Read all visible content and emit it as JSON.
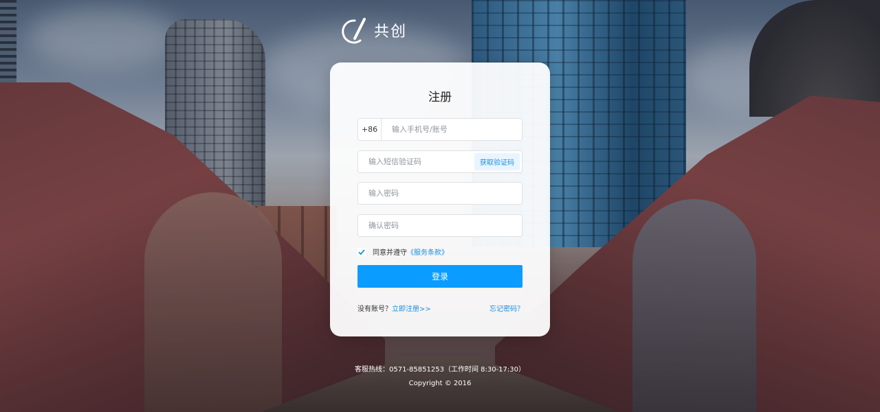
{
  "brand": {
    "name": "共创"
  },
  "form": {
    "title": "注册",
    "phone_prefix": "+86",
    "phone_placeholder": "输入手机号/账号",
    "code_placeholder": "输入短信验证码",
    "get_code_label": "获取验证码",
    "password_placeholder": "输入密码",
    "confirm_placeholder": "确认密码",
    "agree_text": "同意并遵守",
    "terms_label": "《服务条款》",
    "agree_checked": true,
    "submit_label": "登录",
    "no_account_text": "没有账号？",
    "register_link": "立即注册>>",
    "forgot_link": "忘记密码？"
  },
  "footer": {
    "hotline": "客服热线：0571-85851253（工作时间 8:30-17:30）",
    "copyright": "Copyright © 2016"
  },
  "colors": {
    "accent": "#0b9cff",
    "link": "#1a8fe0"
  }
}
